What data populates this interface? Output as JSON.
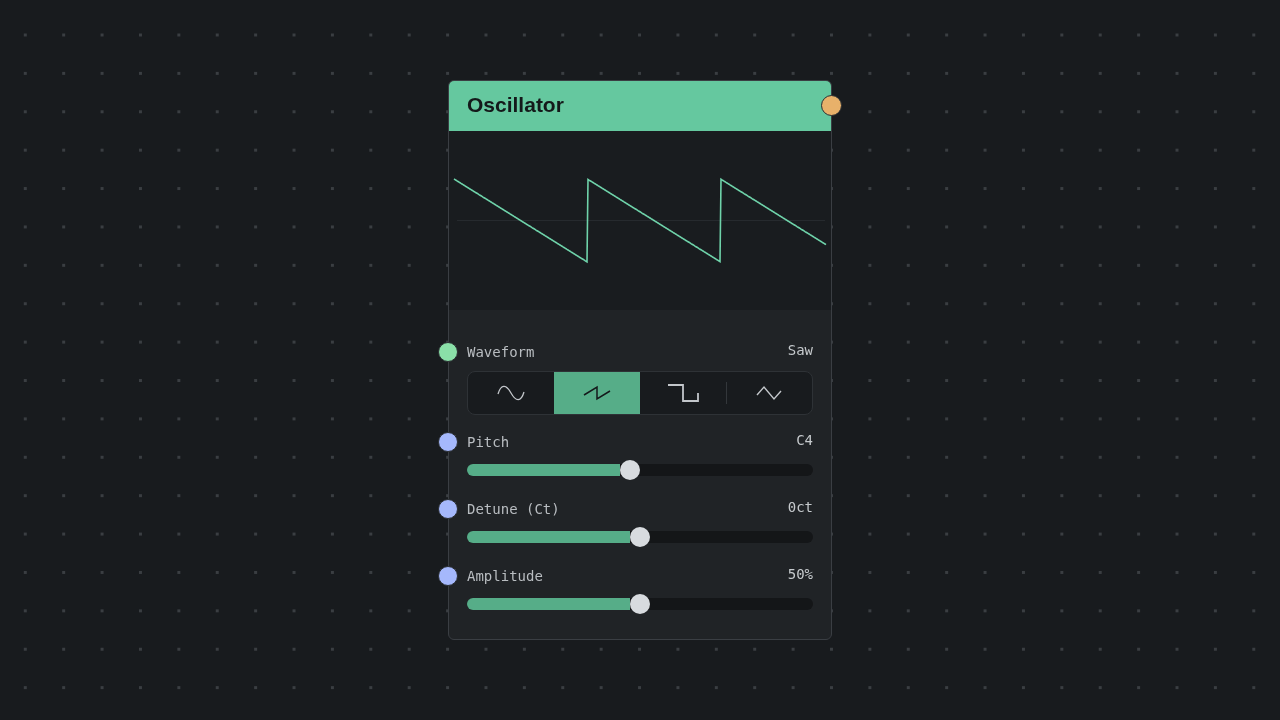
{
  "node": {
    "title": "Oscillator",
    "controls": [
      {
        "kind": "select",
        "label": "Waveform",
        "value": "Saw",
        "color": "#8ae0a8",
        "options": [
          {
            "kind": "sine",
            "selected": false
          },
          {
            "kind": "saw",
            "selected": true
          },
          {
            "kind": "square",
            "selected": false
          },
          {
            "kind": "triangle",
            "selected": false
          }
        ]
      },
      {
        "kind": "slider",
        "label": "Pitch",
        "value": "C4",
        "color": "#a5b8fc",
        "level": 0.47
      },
      {
        "kind": "slider",
        "label": "Detune (Ct)",
        "value": "0ct",
        "color": "#a5b8fc",
        "level": 0.5
      },
      {
        "kind": "slider",
        "label": "Amplitude",
        "value": "50%",
        "color": "#a5b8fc",
        "level": 0.5
      }
    ]
  }
}
